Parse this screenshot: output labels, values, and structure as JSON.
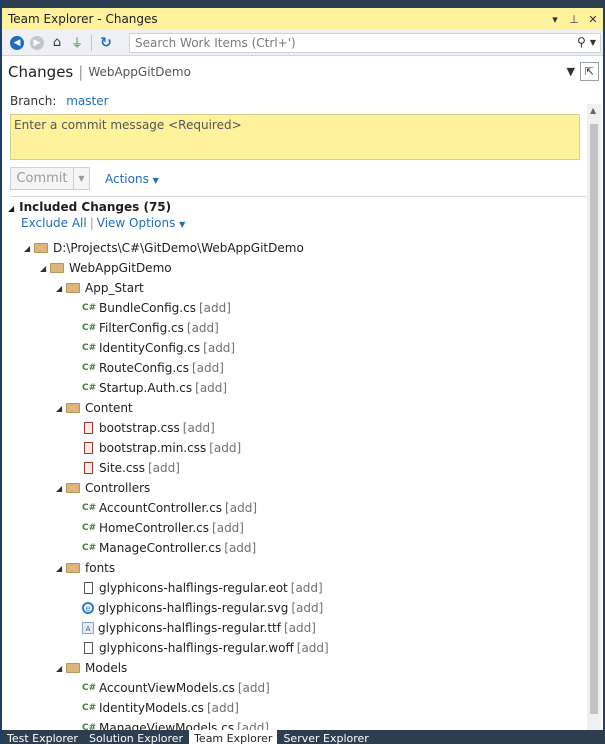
{
  "window": {
    "title": "Team Explorer - Changes"
  },
  "toolbar": {
    "search_placeholder": "Search Work Items (Ctrl+')"
  },
  "header": {
    "title": "Changes",
    "subtitle": "WebAppGitDemo"
  },
  "branch": {
    "label": "Branch:",
    "value": "master"
  },
  "commit": {
    "placeholder": "Enter a commit message <Required>",
    "button_label": "Commit",
    "actions_label": "Actions"
  },
  "included": {
    "title": "Included Changes (75)",
    "exclude_all": "Exclude All",
    "view_options": "View Options"
  },
  "tree": [
    {
      "type": "folder",
      "depth": 0,
      "name": "D:\\Projects\\C#\\GitDemo\\WebAppGitDemo",
      "status": ""
    },
    {
      "type": "folder",
      "depth": 1,
      "name": "WebAppGitDemo",
      "status": ""
    },
    {
      "type": "folder",
      "depth": 2,
      "name": "App_Start",
      "status": ""
    },
    {
      "type": "cs",
      "depth": 3,
      "name": "BundleConfig.cs",
      "status": "[add]"
    },
    {
      "type": "cs",
      "depth": 3,
      "name": "FilterConfig.cs",
      "status": "[add]"
    },
    {
      "type": "cs",
      "depth": 3,
      "name": "IdentityConfig.cs",
      "status": "[add]"
    },
    {
      "type": "cs",
      "depth": 3,
      "name": "RouteConfig.cs",
      "status": "[add]"
    },
    {
      "type": "cs",
      "depth": 3,
      "name": "Startup.Auth.cs",
      "status": "[add]"
    },
    {
      "type": "folder",
      "depth": 2,
      "name": "Content",
      "status": ""
    },
    {
      "type": "css",
      "depth": 3,
      "name": "bootstrap.css",
      "status": "[add]"
    },
    {
      "type": "css",
      "depth": 3,
      "name": "bootstrap.min.css",
      "status": "[add]"
    },
    {
      "type": "css",
      "depth": 3,
      "name": "Site.css",
      "status": "[add]"
    },
    {
      "type": "folder",
      "depth": 2,
      "name": "Controllers",
      "status": ""
    },
    {
      "type": "cs",
      "depth": 3,
      "name": "AccountController.cs",
      "status": "[add]"
    },
    {
      "type": "cs",
      "depth": 3,
      "name": "HomeController.cs",
      "status": "[add]"
    },
    {
      "type": "cs",
      "depth": 3,
      "name": "ManageController.cs",
      "status": "[add]"
    },
    {
      "type": "folder",
      "depth": 2,
      "name": "fonts",
      "status": ""
    },
    {
      "type": "doc",
      "depth": 3,
      "name": "glyphicons-halflings-regular.eot",
      "status": "[add]"
    },
    {
      "type": "svg",
      "depth": 3,
      "name": "glyphicons-halflings-regular.svg",
      "status": "[add]"
    },
    {
      "type": "ttf",
      "depth": 3,
      "name": "glyphicons-halflings-regular.ttf",
      "status": "[add]"
    },
    {
      "type": "doc",
      "depth": 3,
      "name": "glyphicons-halflings-regular.woff",
      "status": "[add]"
    },
    {
      "type": "folder",
      "depth": 2,
      "name": "Models",
      "status": ""
    },
    {
      "type": "cs",
      "depth": 3,
      "name": "AccountViewModels.cs",
      "status": "[add]"
    },
    {
      "type": "cs",
      "depth": 3,
      "name": "IdentityModels.cs",
      "status": "[add]"
    },
    {
      "type": "cs",
      "depth": 3,
      "name": "ManageViewModels.cs",
      "status": "[add]"
    }
  ],
  "tabs": [
    {
      "label": "Test Explorer",
      "active": false
    },
    {
      "label": "Solution Explorer",
      "active": false
    },
    {
      "label": "Team Explorer",
      "active": true
    },
    {
      "label": "Server Explorer",
      "active": false
    }
  ]
}
